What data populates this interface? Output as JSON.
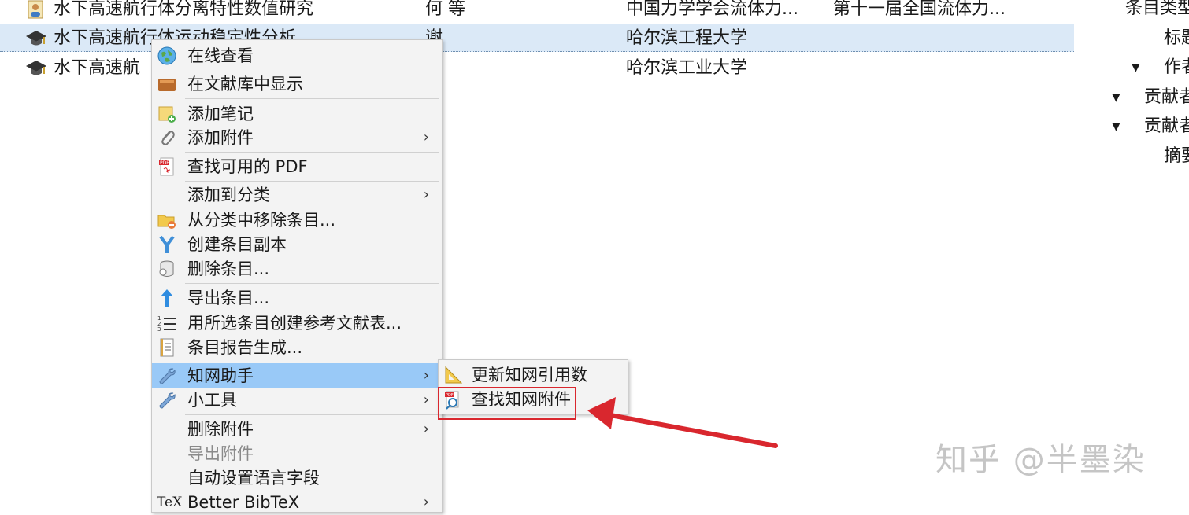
{
  "rows": [
    {
      "title": "水下高速航行体分离特性数值研究",
      "author": "何 等",
      "publisher": "中国力学学会流体力...",
      "conference": "第十一届全国流体力...",
      "icon": "user-doc-icon",
      "selected": false
    },
    {
      "title": "水下高速航行体运动稳定性分析",
      "author": "谢",
      "publisher": "哈尔滨工程大学",
      "conference": "",
      "icon": "graduation-cap-icon",
      "selected": true
    },
    {
      "title": "水下高速航",
      "author": "",
      "publisher": "哈尔滨工业大学",
      "conference": "",
      "icon": "graduation-cap-icon",
      "selected": false
    }
  ],
  "side_panel": {
    "item_type": "条目类型",
    "title_label": "标题",
    "author_label": "作者",
    "contributor1": "贡献者",
    "contributor2": "贡献者",
    "abstract_label": "摘要"
  },
  "context_menu": {
    "items": [
      {
        "label": "在线查看",
        "icon": "globe-icon"
      },
      {
        "label": "在文献库中显示",
        "icon": "library-icon"
      },
      {
        "label": "添加笔记",
        "icon": "note-add-icon"
      },
      {
        "label": "添加附件",
        "icon": "paperclip-icon",
        "submenu": true
      },
      {
        "label": "查找可用的 PDF",
        "icon": "pdf-icon"
      },
      {
        "label": "添加到分类",
        "icon": "",
        "submenu": true
      },
      {
        "label": "从分类中移除条目...",
        "icon": "folder-remove-icon"
      },
      {
        "label": "创建条目副本",
        "icon": "duplicate-icon"
      },
      {
        "label": "删除条目...",
        "icon": "trash-icon"
      },
      {
        "label": "导出条目...",
        "icon": "export-arrow-icon"
      },
      {
        "label": "用所选条目创建参考文献表...",
        "icon": "numbered-list-icon"
      },
      {
        "label": "条目报告生成...",
        "icon": "report-icon"
      },
      {
        "label": "知网助手",
        "icon": "wrench-icon",
        "submenu": true,
        "highlighted": true
      },
      {
        "label": "小工具",
        "icon": "wrench-icon",
        "submenu": true
      },
      {
        "label": "删除附件",
        "icon": "",
        "submenu": true
      },
      {
        "label": "导出附件",
        "icon": "",
        "disabled": true
      },
      {
        "label": "自动设置语言字段",
        "icon": ""
      },
      {
        "label": "Better BibTeX",
        "icon": "tex-icon",
        "submenu": true
      }
    ],
    "arrow_glyph": "›"
  },
  "submenu": {
    "items": [
      {
        "label": "更新知网引用数",
        "icon": "triangle-ruler-icon"
      },
      {
        "label": "查找知网附件",
        "icon": "pdf-search-icon"
      }
    ]
  },
  "watermark": "知乎 @半墨染",
  "colors": {
    "selection": "#dbe9f7",
    "menu_highlight": "#99c9f7",
    "annotation_red": "#d9272e"
  }
}
